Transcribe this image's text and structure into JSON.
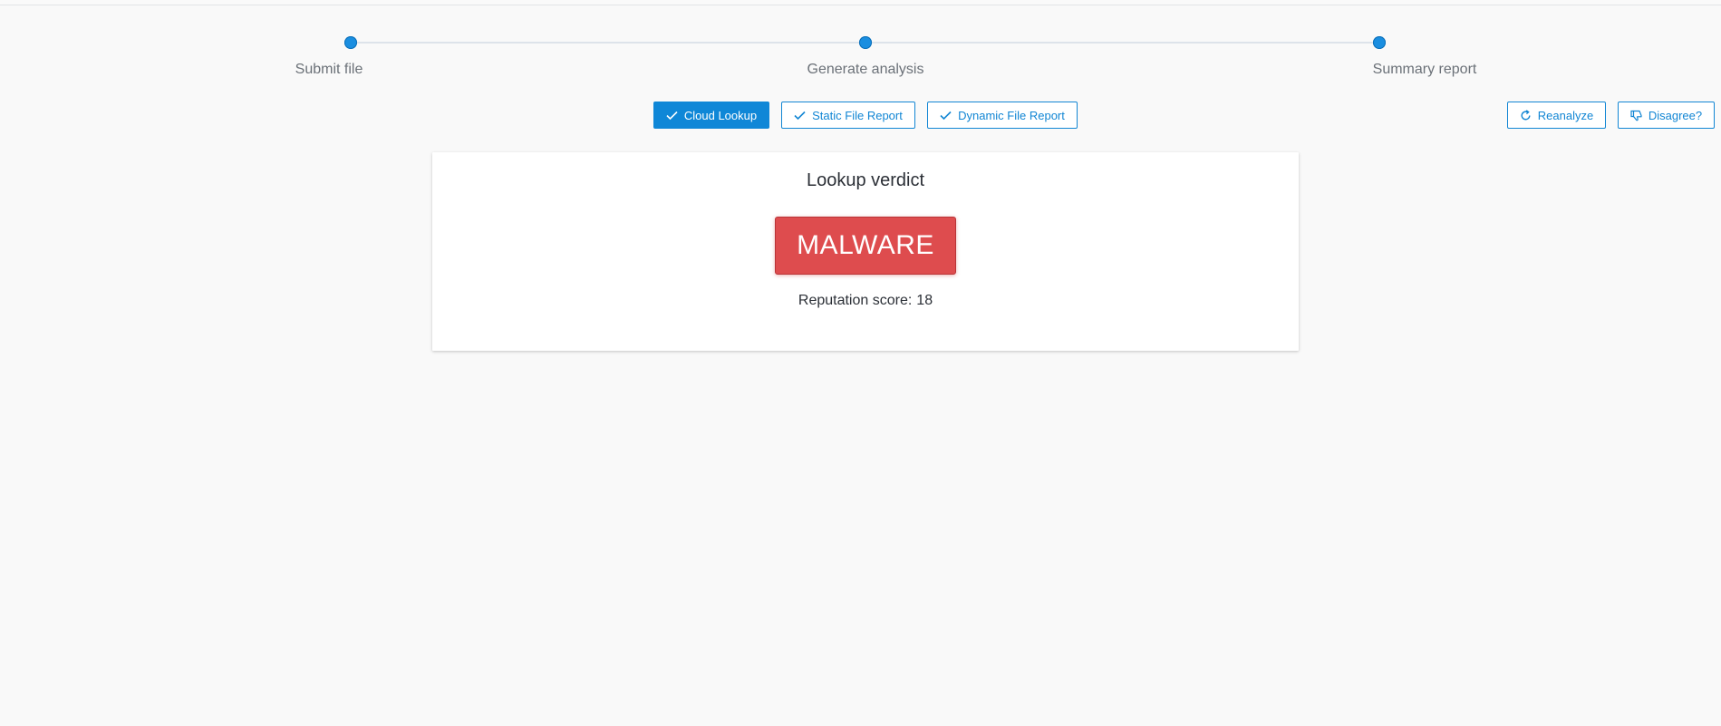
{
  "stepper": {
    "steps": [
      {
        "label": "Submit file"
      },
      {
        "label": "Generate analysis"
      },
      {
        "label": "Summary report"
      }
    ]
  },
  "toolbar": {
    "cloud_lookup_label": "Cloud Lookup",
    "static_report_label": "Static File Report",
    "dynamic_report_label": "Dynamic File Report",
    "reanalyze_label": "Reanalyze",
    "disagree_label": "Disagree?"
  },
  "verdict_card": {
    "title": "Lookup verdict",
    "verdict": "MALWARE",
    "score_label": "Reputation score:",
    "score_value": "18"
  },
  "colors": {
    "accent": "#0f87d7",
    "verdict_bg": "#de4c4e",
    "page_bg": "#f9f9f9"
  },
  "icons": {
    "cloud_lookup": "check-icon",
    "static_report": "check-icon",
    "dynamic_report": "check-icon",
    "reanalyze": "refresh-icon",
    "disagree": "thumbs-down-icon"
  }
}
